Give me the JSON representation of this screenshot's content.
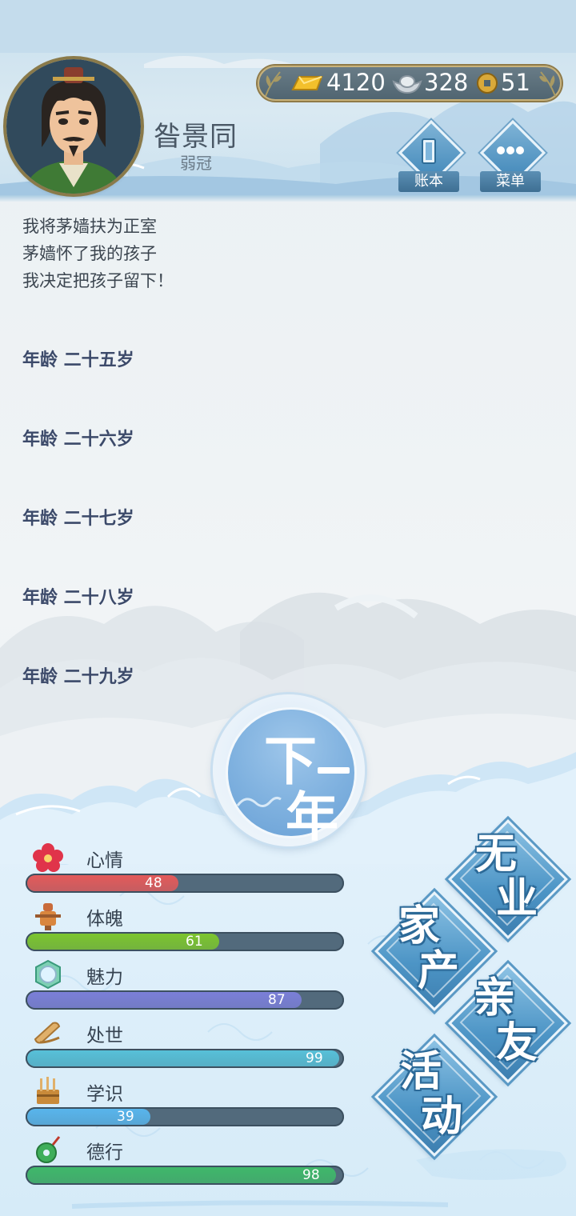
{
  "player": {
    "name": "昝景同",
    "age_title": "弱冠"
  },
  "currency": {
    "gold": "4120",
    "silver": "328",
    "coin": "51"
  },
  "header_buttons": {
    "ledger": "账本",
    "menu": "菜单"
  },
  "log": {
    "lines": [
      "我将茅嫱扶为正室",
      "茅嫱怀了我的孩子",
      "我决定把孩子留下！"
    ],
    "ages": [
      "年龄 二十五岁",
      "年龄 二十六岁",
      "年龄 二十七岁",
      "年龄 二十八岁",
      "年龄 二十九岁"
    ]
  },
  "next_year": {
    "char1": "下",
    "char2": "年"
  },
  "stats": [
    {
      "label": "心情",
      "value": "48",
      "percent": 48,
      "color": "#e35a5a",
      "icon": "flower-icon"
    },
    {
      "label": "体魄",
      "value": "61",
      "percent": 61,
      "color": "#7cc52e",
      "icon": "training-dummy-icon"
    },
    {
      "label": "魅力",
      "value": "87",
      "percent": 87,
      "color": "#7b7fd8",
      "icon": "mirror-icon"
    },
    {
      "label": "处世",
      "value": "99",
      "percent": 99,
      "color": "#57c0d8",
      "icon": "scroll-icon"
    },
    {
      "label": "学识",
      "value": "39",
      "percent": 39,
      "color": "#58b5ec",
      "icon": "brush-stand-icon"
    },
    {
      "label": "德行",
      "value": "98",
      "percent": 98,
      "color": "#3fb86a",
      "icon": "jade-pendant-icon"
    }
  ],
  "side_buttons": {
    "career": [
      "无",
      "业"
    ],
    "estate": [
      "家",
      "产"
    ],
    "relatives": [
      "亲",
      "友"
    ],
    "activities": [
      "活",
      "动"
    ]
  }
}
